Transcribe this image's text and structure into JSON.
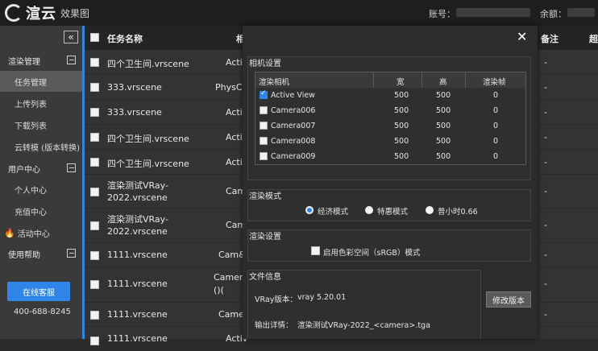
{
  "header": {
    "logo_text": "渲云",
    "logo_sub": "效果图",
    "account_label": "账号：",
    "balance_label": "余额："
  },
  "sidebar": {
    "sections": [
      {
        "label": "渲染管理",
        "items": [
          {
            "label": "任务管理",
            "active": true
          },
          {
            "label": "上传列表",
            "active": false
          },
          {
            "label": "下载列表",
            "active": false
          },
          {
            "label": "云转模 (版本转换)",
            "active": false
          }
        ]
      },
      {
        "label": "用户中心",
        "items": [
          {
            "label": "个人中心",
            "active": false
          },
          {
            "label": "充值中心",
            "active": false
          },
          {
            "label": "活动中心",
            "active": false
          }
        ]
      },
      {
        "label": "使用帮助",
        "items": []
      }
    ],
    "service_button": "在线客服",
    "phone": "400-688-8245"
  },
  "table": {
    "headers": {
      "name": "任务名称",
      "col2": "相",
      "remark": "备注",
      "last": "超"
    },
    "rows": [
      {
        "name": "四个卫生间.vrscene",
        "col2": "Activ",
        "remark": "-"
      },
      {
        "name": "333.vrscene",
        "col2": "PhysCa",
        "remark": "-"
      },
      {
        "name": "333.vrscene",
        "col2": "Activ",
        "remark": "-"
      },
      {
        "name": "四个卫生间.vrscene",
        "col2": "Activ",
        "remark": "-"
      },
      {
        "name": "四个卫生间.vrscene",
        "col2": "Activ",
        "remark": "-"
      },
      {
        "name": "渲染测试VRay-2022.vrscene",
        "col2": "Cam",
        "remark": "-"
      },
      {
        "name": "渲染测试VRay-2022.vrscene",
        "col2": "Cam",
        "remark": "-"
      },
      {
        "name": "1111.vrscene",
        "col2": "Cam&",
        "remark": "-"
      },
      {
        "name": "1111.vrscene",
        "col2": "Camera\n()(",
        "remark": "-"
      },
      {
        "name": "1111.vrscene",
        "col2": "Came&",
        "remark": "-"
      },
      {
        "name": "1111.vrscene",
        "col2": "Activ",
        "remark": ""
      }
    ]
  },
  "modal": {
    "camera_settings_title": "相机设置",
    "camera_table": {
      "headers": [
        "渲染相机",
        "宽",
        "高",
        "渲染帧"
      ],
      "rows": [
        {
          "name": "Active View",
          "w": "500",
          "h": "500",
          "frame": "0",
          "checked": true
        },
        {
          "name": "Camera006",
          "w": "500",
          "h": "500",
          "frame": "0",
          "checked": false
        },
        {
          "name": "Camera007",
          "w": "500",
          "h": "500",
          "frame": "0",
          "checked": false
        },
        {
          "name": "Camera008",
          "w": "500",
          "h": "500",
          "frame": "0",
          "checked": false
        },
        {
          "name": "Camera009",
          "w": "500",
          "h": "500",
          "frame": "0",
          "checked": false
        }
      ]
    },
    "render_mode_title": "渲染模式",
    "render_modes": [
      {
        "label": "经济模式",
        "selected": true
      },
      {
        "label": "特惠模式",
        "selected": false
      },
      {
        "label": "普小时0.66",
        "selected": false
      }
    ],
    "render_settings_title": "渲染设置",
    "color_space_label": "启用色彩空间（sRGB）模式",
    "file_info_title": "文件信息",
    "vray_version_label": "VRay版本：",
    "vray_version_value": "vray 5.20.01",
    "output_label": "输出详情：",
    "output_value": "渲染测试VRay-2022_<camera>.tga",
    "modify_version_button": "修改版本"
  }
}
